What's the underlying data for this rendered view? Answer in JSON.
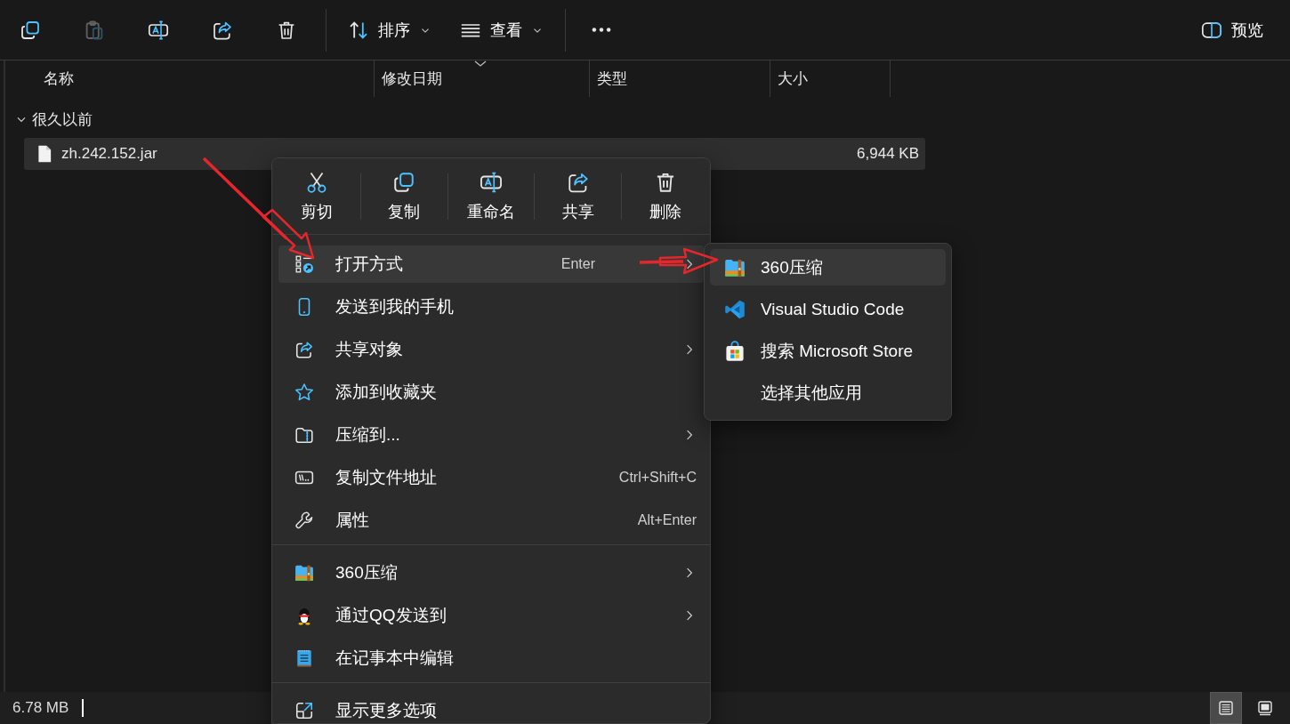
{
  "toolbar": {
    "actions": [
      {
        "kind": "copy",
        "disabled": false
      },
      {
        "kind": "paste",
        "disabled": true
      },
      {
        "kind": "rename",
        "disabled": false
      },
      {
        "kind": "share",
        "disabled": false
      },
      {
        "kind": "delete",
        "disabled": false
      }
    ],
    "sort": {
      "label": "排序"
    },
    "view": {
      "label": "查看"
    },
    "preview": {
      "label": "预览"
    }
  },
  "columns": [
    {
      "label": "名称",
      "sorted": false
    },
    {
      "label": "修改日期",
      "sorted": true
    },
    {
      "label": "类型",
      "sorted": false
    },
    {
      "label": "大小",
      "sorted": false
    }
  ],
  "groups": [
    {
      "label": "很久以前",
      "expanded": true,
      "files": [
        {
          "name": "zh.242.152.jar",
          "size": "6,944 KB",
          "selected": true
        }
      ]
    }
  ],
  "context_menu": {
    "actions": [
      {
        "kind": "cut",
        "label": "剪切"
      },
      {
        "kind": "copy",
        "label": "复制"
      },
      {
        "kind": "rename",
        "label": "重命名"
      },
      {
        "kind": "share",
        "label": "共享"
      },
      {
        "kind": "delete",
        "label": "删除"
      }
    ],
    "sections": [
      [
        {
          "kind": "openwith",
          "label": "打开方式",
          "shortcut": "Enter",
          "submenu": true,
          "selected": true
        },
        {
          "kind": "phone",
          "label": "发送到我的手机",
          "submenu": false,
          "selected": false
        },
        {
          "kind": "share",
          "label": "共享对象",
          "submenu": true,
          "selected": false
        },
        {
          "kind": "star",
          "label": "添加到收藏夹",
          "submenu": false,
          "selected": false
        },
        {
          "kind": "zipfolder",
          "label": "压缩到...",
          "submenu": true,
          "selected": false
        },
        {
          "kind": "path",
          "label": "复制文件地址",
          "shortcut": "Ctrl+Shift+C",
          "submenu": false,
          "selected": false
        },
        {
          "kind": "wrench",
          "label": "属性",
          "shortcut": "Alt+Enter",
          "submenu": false,
          "selected": false
        }
      ],
      [
        {
          "kind": "archive",
          "label": "360压缩",
          "submenu": true,
          "selected": false
        },
        {
          "kind": "qq",
          "label": "通过QQ发送到",
          "submenu": true,
          "selected": false
        },
        {
          "kind": "notepad",
          "label": "在记事本中编辑",
          "submenu": false,
          "selected": false
        }
      ],
      [
        {
          "kind": "moreopts",
          "label": "显示更多选项",
          "submenu": false,
          "selected": false
        }
      ]
    ]
  },
  "submenu": {
    "items": [
      {
        "kind": "archive",
        "label": "360压缩",
        "selected": true
      },
      {
        "kind": "vscode",
        "label": "Visual Studio Code",
        "selected": false
      },
      {
        "kind": "store",
        "label": "搜索 Microsoft Store",
        "selected": false
      },
      {
        "kind": "none",
        "label": "选择其他应用",
        "selected": false
      }
    ]
  },
  "status_bar": {
    "size": "6.78 MB",
    "views": [
      {
        "kind": "details",
        "selected": true
      },
      {
        "kind": "tiles",
        "selected": false
      }
    ]
  }
}
